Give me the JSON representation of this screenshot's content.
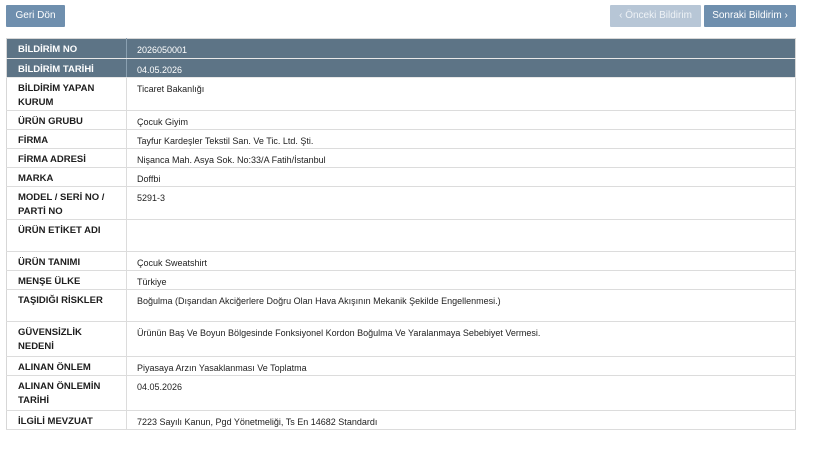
{
  "toolbar": {
    "back_label": "Geri Dön",
    "prev_label": "Önceki Bildirim",
    "next_label": "Sonraki Bildirim",
    "prev_icon": "chevron-left-icon",
    "next_icon": "chevron-right-icon"
  },
  "colors": {
    "primary_button": "#6f8fae",
    "disabled_button": "#b7c6d6",
    "header_row": "#5d7486"
  },
  "details": [
    {
      "label": "BİLDİRİM NO",
      "value": "2026050001",
      "header": true
    },
    {
      "label": "BİLDİRİM TARİHİ",
      "value": "04.05.2026",
      "header": true
    },
    {
      "label": "BİLDİRİM YAPAN KURUM",
      "value": "Ticaret Bakanlığı"
    },
    {
      "label": "ÜRÜN GRUBU",
      "value": "Çocuk Giyim"
    },
    {
      "label": "FİRMA",
      "value": "Tayfur Kardeşler Tekstil San. Ve Tic. Ltd. Şti."
    },
    {
      "label": "FİRMA ADRESİ",
      "value": "Nişanca Mah. Asya Sok. No:33/A Fatih/İstanbul"
    },
    {
      "label": "MARKA",
      "value": "Doffbi"
    },
    {
      "label": "MODEL / SERİ NO / PARTİ NO",
      "value": "5291-3"
    },
    {
      "label": "ÜRÜN ETİKET ADI",
      "value": ""
    },
    {
      "label": "ÜRÜN TANIMI",
      "value": "Çocuk Sweatshirt"
    },
    {
      "label": "MENŞE ÜLKE",
      "value": "Türkiye"
    },
    {
      "label": "TAŞIDIĞI RİSKLER",
      "value": "Boğulma (Dışarıdan Akciğerlere Doğru Olan Hava Akışının Mekanik Şekilde Engellenmesi.)"
    },
    {
      "label": "GÜVENSİZLİK NEDENİ",
      "value": "Ürünün Baş Ve Boyun Bölgesinde Fonksiyonel Kordon Boğulma Ve Yaralanmaya Sebebiyet Vermesi."
    },
    {
      "label": "ALINAN ÖNLEM",
      "value": "Piyasaya Arzın Yasaklanması Ve Toplatma"
    },
    {
      "label": "ALINAN ÖNLEMİN TARİHİ",
      "value": "04.05.2026"
    },
    {
      "label": "İLGİLİ MEVZUAT",
      "value": "7223 Sayılı Kanun, Pgd Yönetmeliği, Ts En 14682 Standardı"
    }
  ]
}
